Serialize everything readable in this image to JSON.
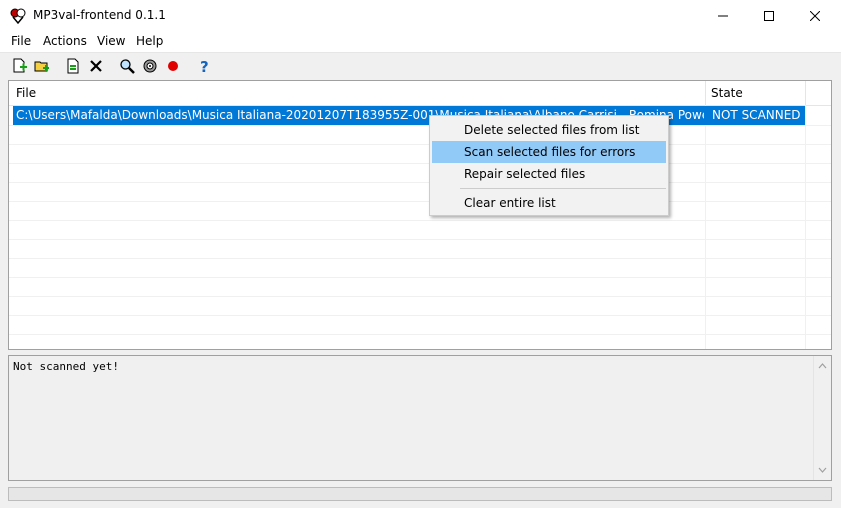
{
  "window": {
    "title": "MP3val-frontend 0.1.1"
  },
  "menubar": {
    "items": [
      {
        "label": "File"
      },
      {
        "label": "Actions"
      },
      {
        "label": "View"
      },
      {
        "label": "Help"
      }
    ]
  },
  "toolbar": {
    "icons": [
      "add-files-icon",
      "add-folder-icon",
      "scan-file-icon",
      "delete-icon",
      "search-icon",
      "settings-gear-icon",
      "stop-record-icon",
      "help-icon"
    ]
  },
  "list": {
    "columns": [
      "File",
      "State"
    ],
    "rows": [
      {
        "file": "C:\\Users\\Mafalda\\Downloads\\Musica Italiana-20201207T183955Z-001\\Musica Italiana\\Albano Carrisi - Romina Power - FELICITA ...",
        "state": "NOT SCANNED",
        "selected": true
      }
    ]
  },
  "context_menu": {
    "items": [
      {
        "label": "Delete selected files from list"
      },
      {
        "label": "Scan selected files for errors",
        "highlighted": true
      },
      {
        "label": "Repair selected files"
      },
      {
        "label": "Clear entire list"
      }
    ]
  },
  "output": {
    "text": "Not scanned yet!"
  },
  "colors": {
    "selection": "#0078d7",
    "menu_highlight": "#91c9f7",
    "record": "#e00000",
    "help": "#1565c0"
  }
}
